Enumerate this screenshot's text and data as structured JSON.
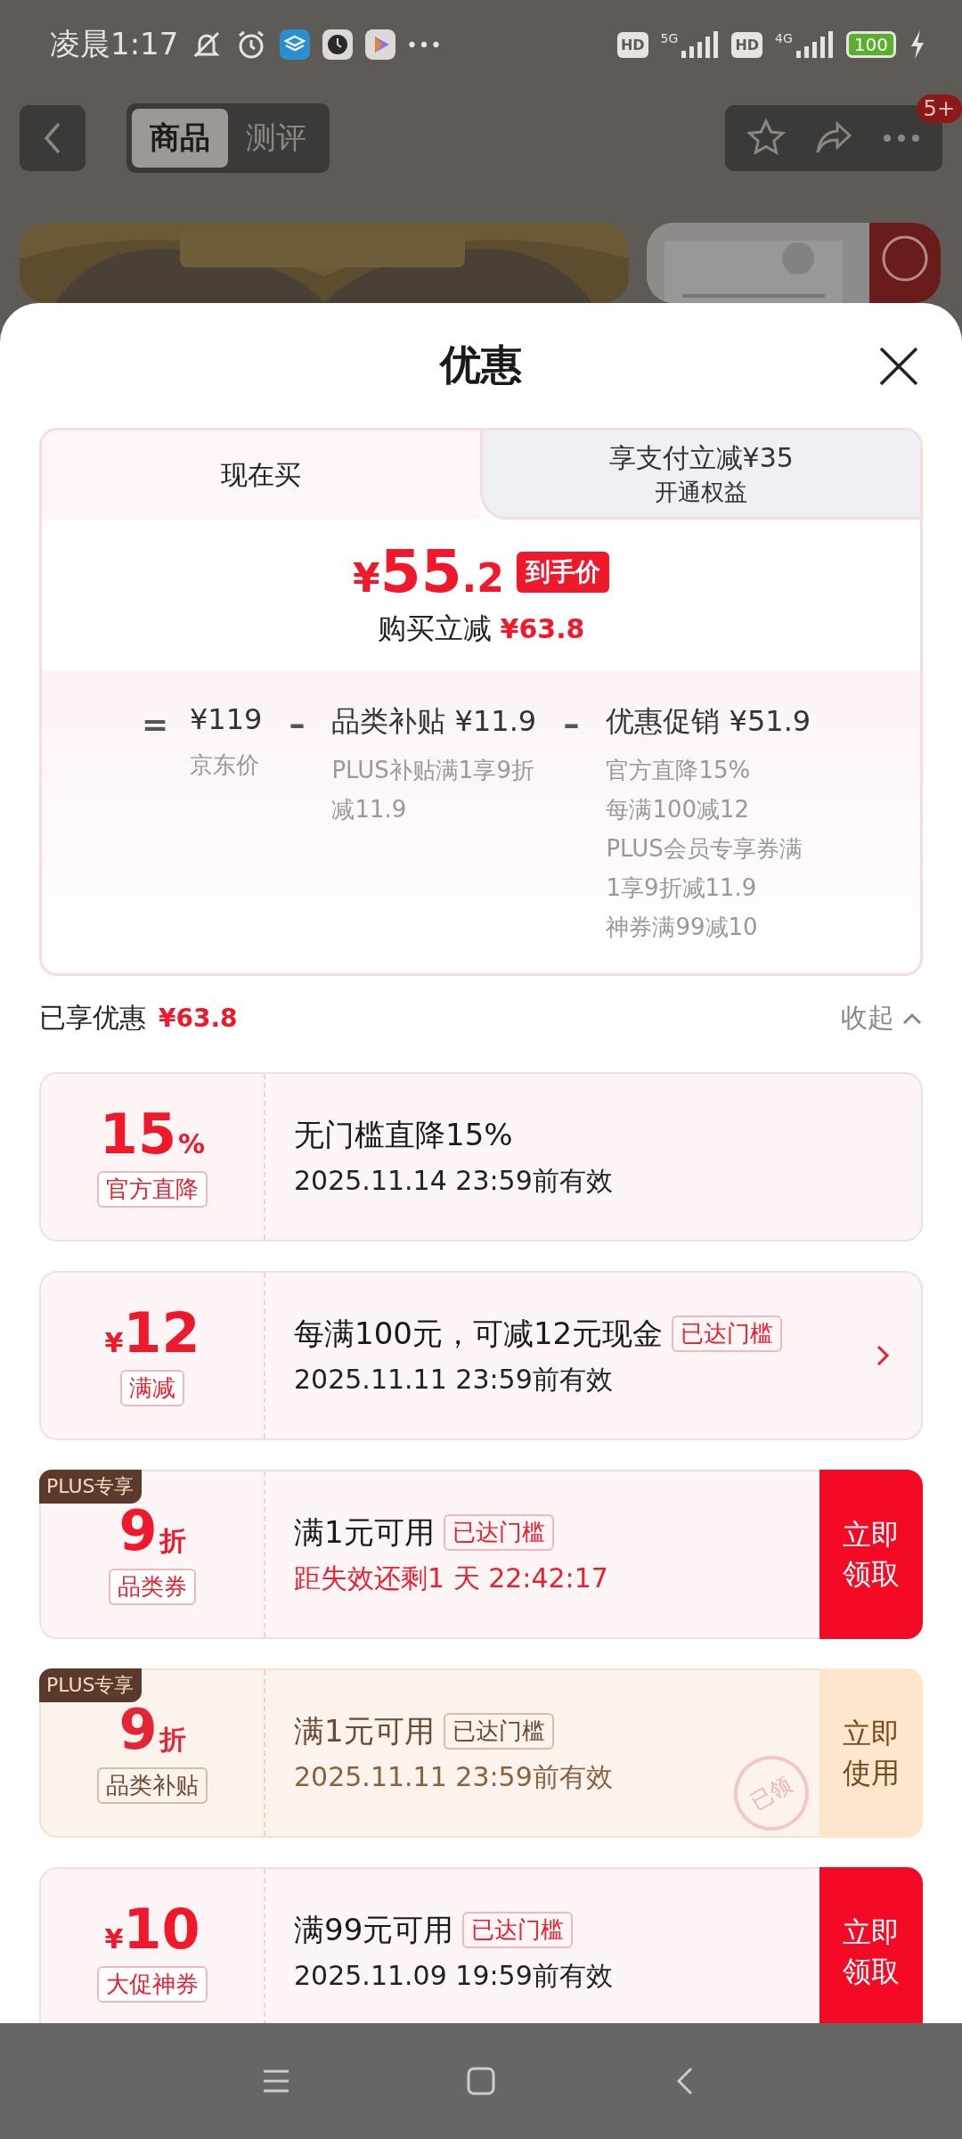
{
  "status_bar": {
    "time": "凌晨1:17",
    "sim1_label": "HD",
    "sim1_network": "5G",
    "sim2_label": "HD",
    "sim2_network": "4G",
    "battery": "100"
  },
  "top_nav": {
    "tabs": [
      {
        "label": "商品",
        "selected": true
      },
      {
        "label": "测评",
        "selected": false
      }
    ],
    "badge": "5+"
  },
  "sheet": {
    "title": "优惠",
    "price_tabs": [
      {
        "label": "现在买",
        "selected": true
      },
      {
        "label": "享支付立减¥35",
        "sublabel": "开通权益",
        "selected": false
      }
    ],
    "final_price": {
      "currency": "¥",
      "integer": "55",
      "decimal": ".2",
      "tag": "到手价",
      "saving_label": "购买立减",
      "saving": "¥63.8"
    },
    "breakdown": [
      {
        "operator": "=",
        "amount": "¥119",
        "notes": [
          "京东价"
        ]
      },
      {
        "operator": "–",
        "title": "品类补贴",
        "amount": "¥11.9",
        "notes": [
          "PLUS补贴满1享9折减11.9"
        ]
      },
      {
        "operator": "–",
        "title": "优惠促销",
        "amount": "¥51.9",
        "notes": [
          "官方直降15%",
          "每满100减12",
          "PLUS会员专享券满1享9折减11.9",
          "神券满99减10"
        ]
      }
    ],
    "summary": {
      "label": "已享优惠",
      "amount": "¥63.8",
      "toggle": "收起",
      "expanded": true
    },
    "coupons": [
      {
        "kind": "plain",
        "amount": "15",
        "amount_suffix": "%",
        "tag": "官方直降",
        "title": "无门槛直降15%",
        "subtitle": "2025.11.14 23:59前有效",
        "urgent": false,
        "has_arrow": false
      },
      {
        "kind": "plain",
        "amount_prefix": "¥",
        "amount": "12",
        "tag": "满减",
        "title": "每满100元，可减12元现金",
        "threshold": "已达门槛",
        "subtitle": "2025.11.11 23:59前有效",
        "urgent": false,
        "has_arrow": true
      },
      {
        "kind": "claim",
        "badge": "PLUS专享",
        "amount": "9",
        "amount_suffix": "折",
        "tag": "品类券",
        "title": "满1元可用",
        "threshold": "已达门槛",
        "subtitle": "距失效还剩1 天 22:42:17",
        "urgent": true,
        "has_arrow": false,
        "action": "立即领取"
      },
      {
        "kind": "use",
        "badge": "PLUS专享",
        "amount": "9",
        "amount_suffix": "折",
        "tag": "品类补贴",
        "title": "满1元可用",
        "threshold": "已达门槛",
        "subtitle": "2025.11.11 23:59前有效",
        "urgent": false,
        "has_arrow": false,
        "action": "立即使用",
        "stamp": "已领"
      },
      {
        "kind": "claim",
        "amount_prefix": "¥",
        "amount": "10",
        "tag": "大促神券",
        "title": "满99元可用",
        "threshold": "已达门槛",
        "subtitle": "2025.11.09 19:59前有效",
        "urgent": false,
        "has_arrow": false,
        "action": "立即领取"
      }
    ]
  }
}
